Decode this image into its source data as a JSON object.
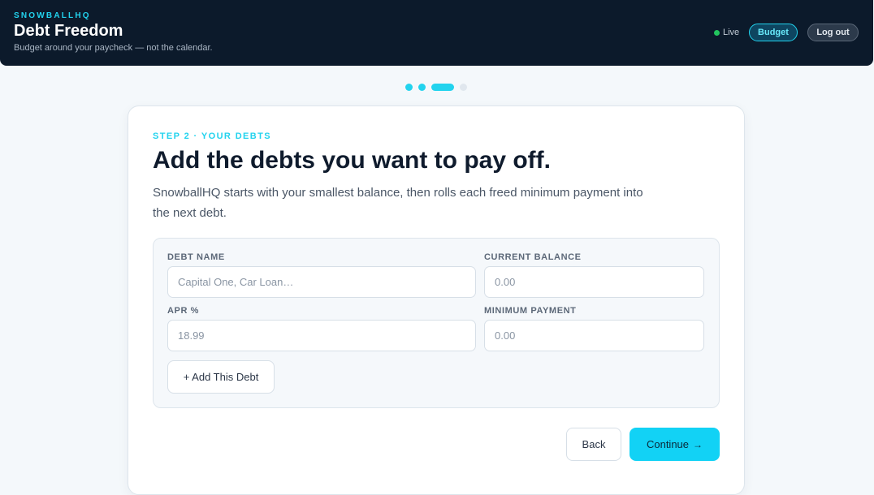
{
  "header": {
    "kicker": "SNOWBALLHQ",
    "title": "Debt Freedom",
    "subtitle": "Budget around your paycheck — not the calendar.",
    "live_label": "Live",
    "budget_label": "Budget",
    "logout_label": "Log out"
  },
  "progress": {
    "total_steps": 4,
    "current_step": 3
  },
  "card": {
    "step_label": "STEP 2 · YOUR DEBTS",
    "title": "Add the debts you want to pay off.",
    "description": "SnowballHQ starts with your smallest balance, then rolls each freed minimum payment into the next debt."
  },
  "form": {
    "debt_name": {
      "label": "DEBT NAME",
      "placeholder": "Capital One, Car Loan…",
      "value": ""
    },
    "current_balance": {
      "label": "CURRENT BALANCE",
      "placeholder": "0.00",
      "value": ""
    },
    "apr": {
      "label": "APR %",
      "placeholder": "18.99",
      "value": ""
    },
    "minimum_payment": {
      "label": "MINIMUM PAYMENT",
      "placeholder": "0.00",
      "value": ""
    },
    "add_label": "+ Add This Debt"
  },
  "actions": {
    "back_label": "Back",
    "continue_label": "Continue",
    "continue_arrow": "→"
  },
  "colors": {
    "accent": "#22d3ee",
    "header_bg": "#0c1a2b",
    "live_dot": "#22c55e",
    "inactive_step": "#e0e7ee"
  }
}
